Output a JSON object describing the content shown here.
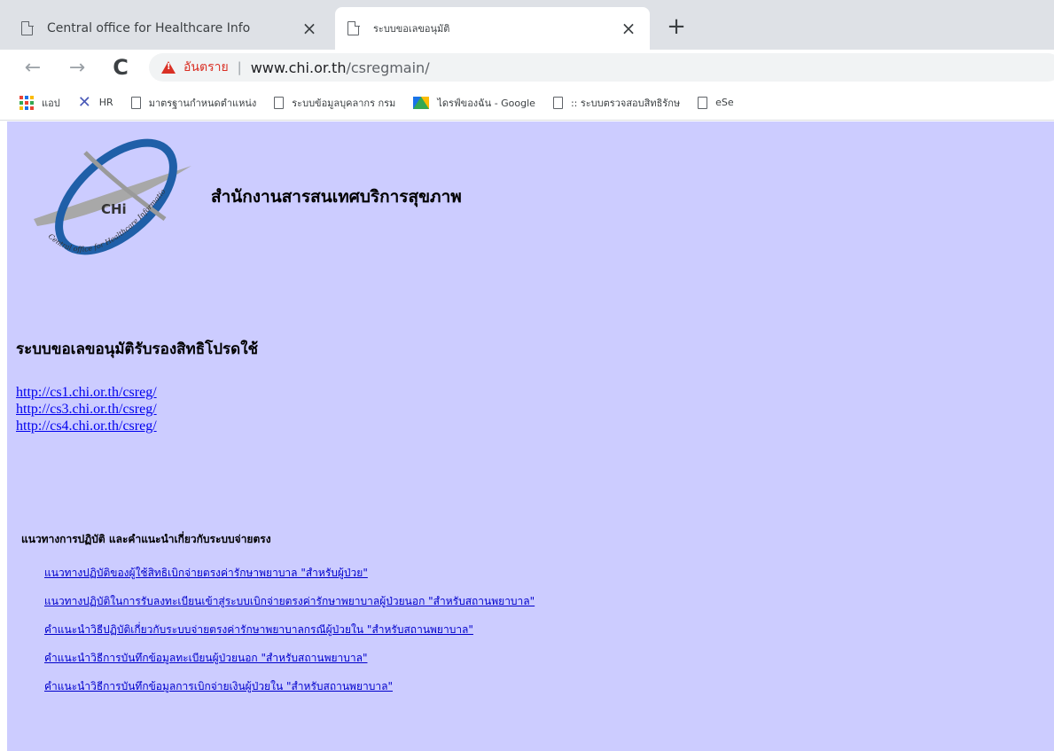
{
  "browser": {
    "tabs": [
      {
        "title": "Central office for Healthcare Info",
        "active": false
      },
      {
        "title": "ระบบขอเลขอนุมัติ",
        "active": true
      }
    ],
    "tab_close_symbol": "×",
    "new_tab_symbol": "+",
    "nav": {
      "back_symbol": "←",
      "forward_symbol": "→",
      "reload_symbol": "C"
    },
    "omnibox": {
      "security_text": "อันตราย",
      "separator": "|",
      "url_host": "www.chi.or.th",
      "url_path": "/csregmain/"
    },
    "bookmarks": [
      {
        "label": "แอป",
        "icon": "apps-grid-icon"
      },
      {
        "label": "HR",
        "icon": "hr-logo-icon"
      },
      {
        "label": "มาตรฐานกำหนดตำแหน่ง",
        "icon": "page-icon"
      },
      {
        "label": "ระบบข้อมูลบุคลากร กรม",
        "icon": "page-icon"
      },
      {
        "label": "ไดรฟ์ของฉัน - Google",
        "icon": "google-drive-icon"
      },
      {
        "label": ":: ระบบตรวจสอบสิทธิรักษ",
        "icon": "page-icon"
      },
      {
        "label": "eSe",
        "icon": "page-icon"
      }
    ]
  },
  "page": {
    "logo_text": "CHi",
    "logo_ring_text": "Central office for Healthcare Information",
    "org_title": "สำนักงานสารสนเทศบริการสุขภาพ",
    "section_title": "ระบบขอเลขอนุมัติรับรองสิทธิโปรดใช้",
    "cs_links": [
      "http://cs1.chi.or.th/csreg/",
      "http://cs3.chi.or.th/csreg/",
      "http://cs4.chi.or.th/csreg/"
    ],
    "guide_heading": "แนวทางการปฏิบัติ และคำแนะนำเกี่ยวกับระบบจ่ายตรง",
    "guide_links": [
      "แนวทางปฏิบัติของผู้ใช้สิทธิเบิกจ่ายตรงค่ารักษาพยาบาล \"สำหรับผู้ป่วย\"",
      "แนวทางปฏิบัติในการรับลงทะเบียนเข้าสู่ระบบเบิกจ่ายตรงค่ารักษาพยาบาลผู้ป่วยนอก \"สำหรับสถานพยาบาล\"",
      "คำแนะนำวิธีปฏิบัติเกี่ยวกับระบบจ่ายตรงค่ารักษาพยาบาลกรณีผู้ป่วยใน \"สำหรับสถานพยาบาล\"",
      "คำแนะนำวิธีการบันทึกข้อมูลทะเบียนผู้ป่วยนอก \"สำหรับสถานพยาบาล\"",
      "คำแนะนำวิธีการบันทึกข้อมูลการเบิกจ่ายเงินผู้ป่วยใน \"สำหรับสถานพยาบาล\""
    ],
    "colors": {
      "page_background": "#ccccff",
      "link": "#0000ee",
      "logo_blue": "#1f5fa8",
      "warning_red": "#d93025"
    }
  }
}
